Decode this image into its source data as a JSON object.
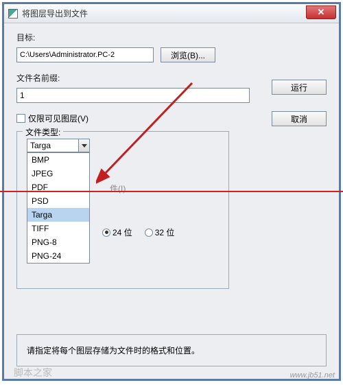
{
  "title": "将图层导出到文件",
  "labels": {
    "target": "目标:",
    "filename": "文件名前缀:",
    "visible_only": "仅限可见图层(V)",
    "filetype": "文件类型:",
    "icc": "件(I)"
  },
  "path_value": "C:\\Users\\Administrator.PC-2",
  "name_value": "1",
  "buttons": {
    "browse": "浏览(B)...",
    "run": "运行",
    "cancel": "取消"
  },
  "combo_value": "Targa",
  "dropdown": [
    "BMP",
    "JPEG",
    "PDF",
    "PSD",
    "Targa",
    "TIFF",
    "PNG-8",
    "PNG-24"
  ],
  "radios": {
    "r24": "24 位",
    "r32": "32 位"
  },
  "bottom_note": "请指定将每个图层存储为文件时的格式和位置。",
  "watermark": "www.jb51.net",
  "watermark_cn": "脚本之家"
}
